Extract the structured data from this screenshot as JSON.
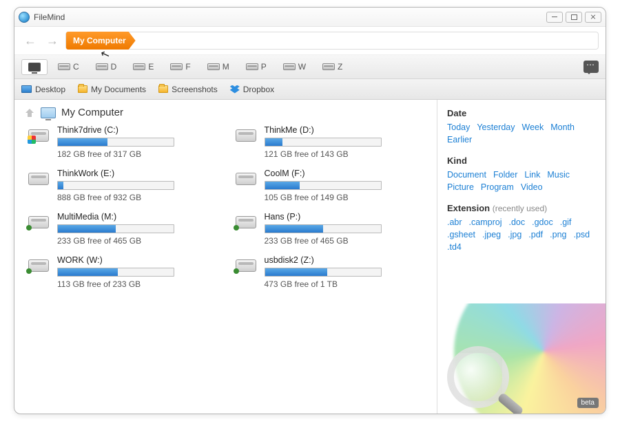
{
  "app": {
    "title": "FileMind"
  },
  "breadcrumb": {
    "label": "My Computer"
  },
  "drivebar": {
    "letters": [
      "C",
      "D",
      "E",
      "F",
      "M",
      "P",
      "W",
      "Z"
    ]
  },
  "favorites": [
    {
      "icon": "desktop",
      "label": "Desktop"
    },
    {
      "icon": "folder",
      "label": "My Documents"
    },
    {
      "icon": "folder",
      "label": "Screenshots"
    },
    {
      "icon": "dropbox",
      "label": "Dropbox"
    }
  ],
  "location": {
    "title": "My Computer"
  },
  "drives": [
    {
      "name": "Think7drive (C:)",
      "free": "182 GB free of 317 GB",
      "pct": 43,
      "kind": "win"
    },
    {
      "name": "ThinkMe (D:)",
      "free": "121 GB free of 143 GB",
      "pct": 15,
      "kind": "hdd"
    },
    {
      "name": "ThinkWork (E:)",
      "free": "888 GB free of 932 GB",
      "pct": 5,
      "kind": "hdd"
    },
    {
      "name": "CoolM (F:)",
      "free": "105 GB free of 149 GB",
      "pct": 30,
      "kind": "hdd"
    },
    {
      "name": "MultiMedia (M:)",
      "free": "233 GB free of 465 GB",
      "pct": 50,
      "kind": "usb"
    },
    {
      "name": "Hans (P:)",
      "free": "233 GB free of 465 GB",
      "pct": 50,
      "kind": "usb"
    },
    {
      "name": "WORK (W:)",
      "free": "113 GB free of 233 GB",
      "pct": 52,
      "kind": "usb"
    },
    {
      "name": "usbdisk2 (Z:)",
      "free": "473 GB free of 1 TB",
      "pct": 54,
      "kind": "usb"
    }
  ],
  "side": {
    "date": {
      "title": "Date",
      "items": [
        "Today",
        "Yesterday",
        "Week",
        "Month",
        "Earlier"
      ]
    },
    "kind": {
      "title": "Kind",
      "items": [
        "Document",
        "Folder",
        "Link",
        "Music",
        "Picture",
        "Program",
        "Video"
      ]
    },
    "ext": {
      "title": "Extension",
      "sub": "(recently used)",
      "items": [
        ".abr",
        ".camproj",
        ".doc",
        ".gdoc",
        ".gif",
        ".gsheet",
        ".jpeg",
        ".jpg",
        ".pdf",
        ".png",
        ".psd",
        ".td4"
      ]
    },
    "beta": "beta"
  }
}
